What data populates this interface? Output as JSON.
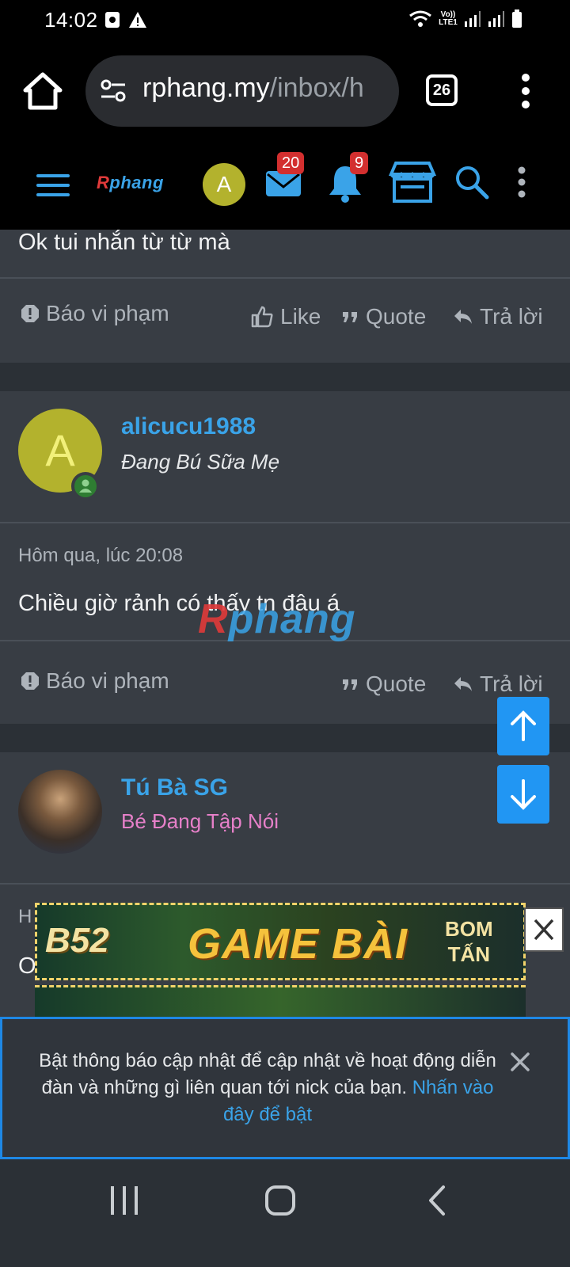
{
  "status_bar": {
    "time": "14:02",
    "lte": "Vo)) LTE1"
  },
  "browser": {
    "url_host": "rphang.my",
    "url_path": "/inbox/h",
    "tab_count": "26"
  },
  "forum_header": {
    "logo": "Rphang",
    "avatar_letter": "A",
    "messages_badge": "20",
    "alerts_badge": "9"
  },
  "posts": [
    {
      "text": "Ok tui nhắn từ từ mà",
      "actions": {
        "report": "Báo vi phạm",
        "like": "Like",
        "quote": "Quote",
        "reply": "Trả lời"
      }
    },
    {
      "author": "alicucu1988",
      "author_title": "Đang Bú Sữa Mẹ",
      "avatar_letter": "A",
      "date": "Hôm qua, lúc 20:08",
      "text": "Chiều giờ rảnh có thấy tn đâu á",
      "actions": {
        "report": "Báo vi phạm",
        "quote": "Quote",
        "reply": "Trả lời"
      }
    },
    {
      "author": "Tú Bà SG",
      "author_title": "Bé Đang Tập Nói",
      "date_partial": "H",
      "text_partial": "O"
    }
  ],
  "watermark": "Rphang",
  "ad": {
    "brand": "B52",
    "headline": "GAME BÀI",
    "tagline_1": "BOM",
    "tagline_2": "TẤN"
  },
  "notification_prompt": {
    "text": "Bật thông báo cập nhật để cập nhật về hoạt động diễn đàn và những gì liên quan tới nick của bạn.",
    "link": "Nhấn vào đây để bật"
  },
  "colors": {
    "accent": "#3aa3e8",
    "badge": "#d32f2f",
    "scroll_button": "#2196f3",
    "card": "#383d44",
    "background": "#2b3036"
  }
}
